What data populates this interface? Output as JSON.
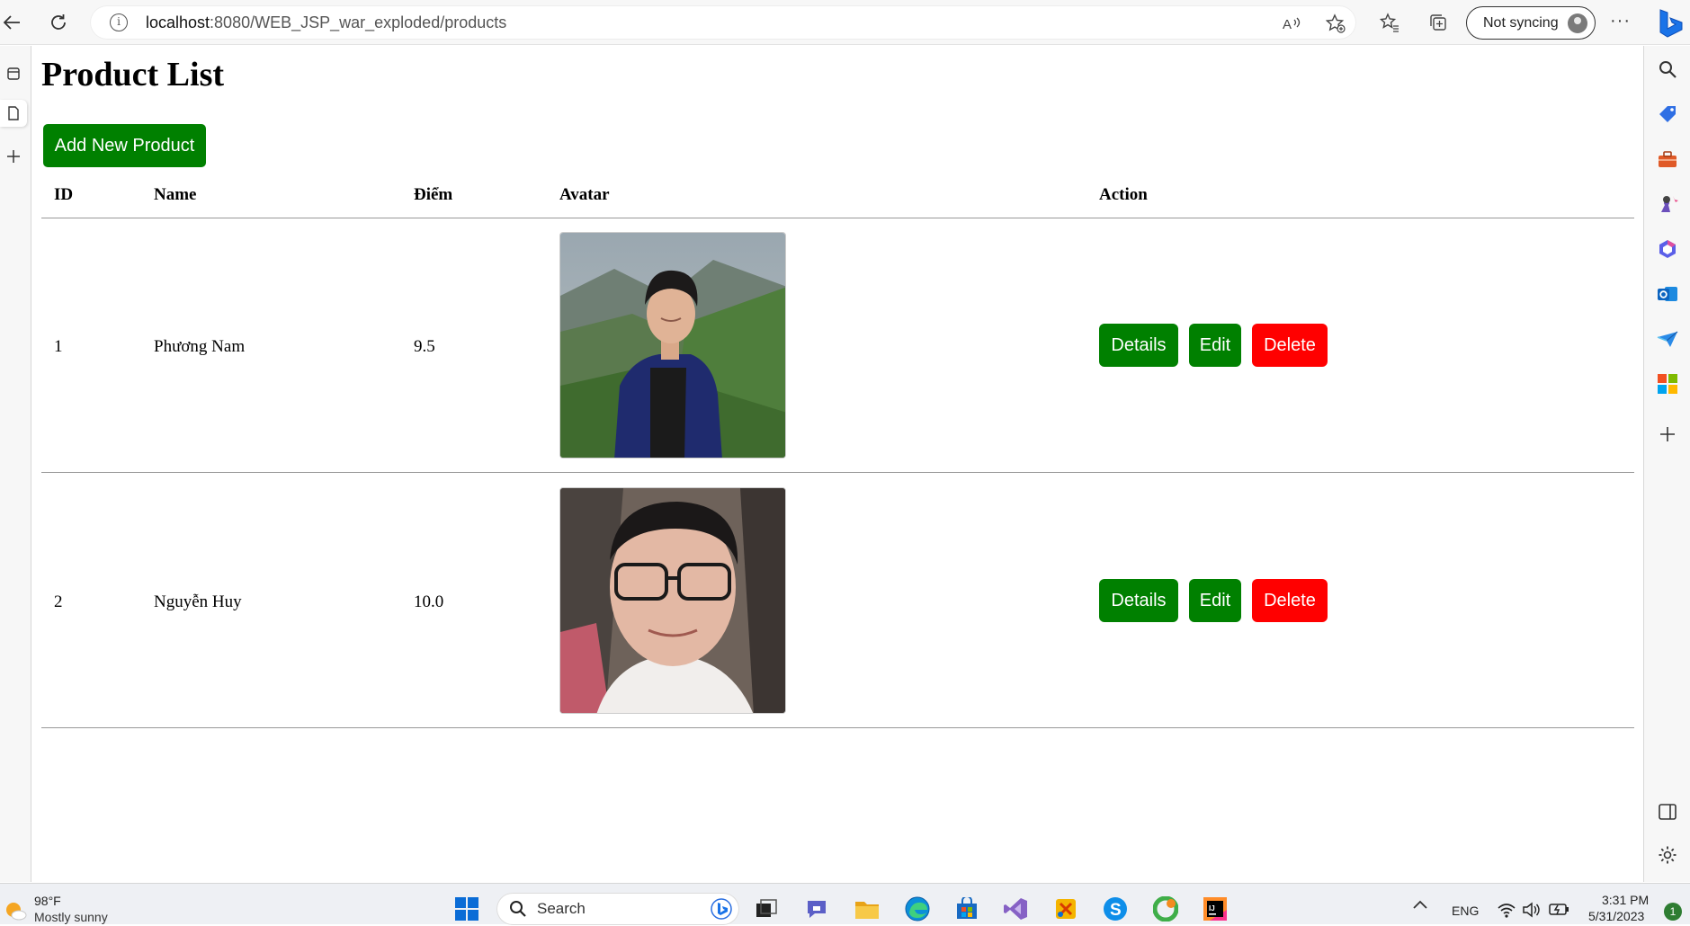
{
  "browser": {
    "url_host": "localhost",
    "url_path": ":8080/WEB_JSP_war_exploded/products",
    "sync_label": "Not syncing",
    "more_label": "···"
  },
  "page": {
    "title": "Product List",
    "add_button": "Add New Product",
    "columns": [
      "ID",
      "Name",
      "Điểm",
      "Avatar",
      "Action"
    ],
    "rows": [
      {
        "id": "1",
        "name": "Phương Nam",
        "score": "9.5"
      },
      {
        "id": "2",
        "name": "Nguyễn Huy",
        "score": "10.0"
      }
    ],
    "actions": {
      "details": "Details",
      "edit": "Edit",
      "delete": "Delete"
    }
  },
  "colors": {
    "green_button": "#008000",
    "red_button": "#ff0000"
  },
  "taskbar": {
    "temperature": "98°F",
    "weather": "Mostly sunny",
    "search_label": "Search",
    "language": "ENG",
    "time": "3:31 PM",
    "date": "5/31/2023",
    "notification_count": "1"
  }
}
